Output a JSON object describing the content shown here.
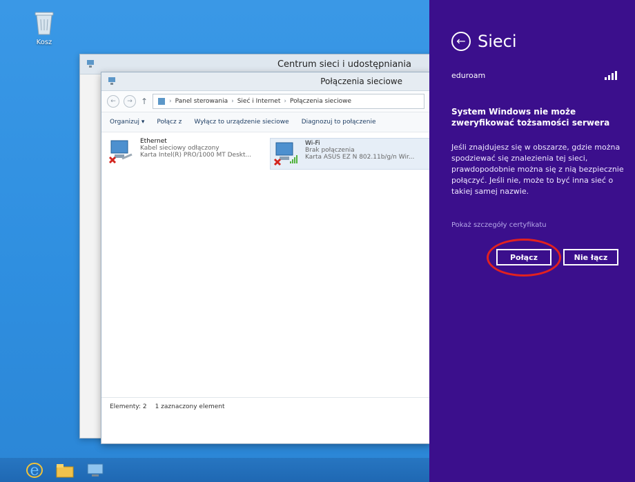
{
  "desktop": {
    "recycle_bin_label": "Kosz"
  },
  "windows": {
    "back_title": "Centrum sieci i udostępniania",
    "front_title": "Połączenia sieciowe",
    "breadcrumb": [
      "Panel sterowania",
      "Sieć i Internet",
      "Połączenia sieciowe"
    ],
    "toolbar": [
      "Organizuj ▾",
      "Połącz z",
      "Wyłącz to urządzenie sieciowe",
      "Diagnozuj to połączenie"
    ],
    "connections": [
      {
        "name": "Ethernet",
        "status": "Kabel sieciowy odłączony",
        "adapter": "Karta Intel(R) PRO/1000 MT Deskt..."
      },
      {
        "name": "Wi-Fi",
        "status": "Brak połączenia",
        "adapter": "Karta ASUS EZ N 802.11b/g/n Wir..."
      }
    ],
    "status_bar": {
      "items_count": "Elementy: 2",
      "selected": "1 zaznaczony element"
    }
  },
  "charm": {
    "title": "Sieci",
    "network_name": "eduroam",
    "heading": "System Windows nie może zweryfikować tożsamości serwera",
    "body": "Jeśli znajdujesz się w obszarze, gdzie można spodziewać się znalezienia tej sieci, prawdopodobnie można się z nią bezpiecznie połączyć. Jeśli nie, może to być inna sieć o takiej samej nazwie.",
    "cert_link": "Pokaż szczegóły certyfikatu",
    "connect_label": "Połącz",
    "dont_connect_label": "Nie łącz"
  },
  "colors": {
    "charm_bg": "#3b0f8c",
    "highlight_ring": "#e2211f",
    "desktop_blue": "#2f8fe0"
  }
}
